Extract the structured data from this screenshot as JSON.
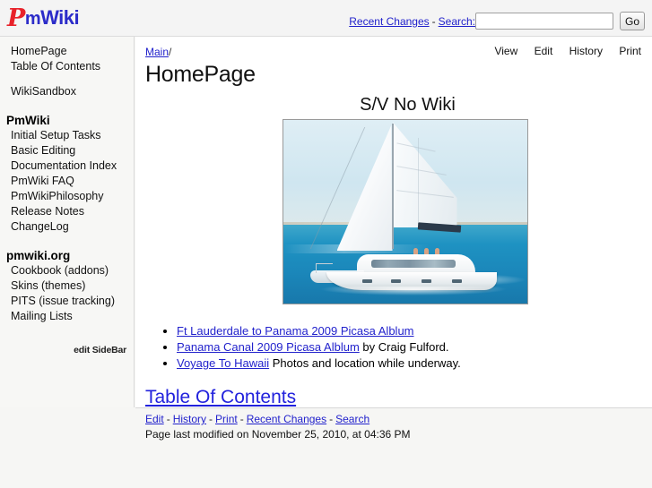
{
  "header": {
    "logo": {
      "p": "P",
      "m": "m",
      "wiki": "Wiki",
      "alt": "PmWiki"
    },
    "recent_changes_label": "Recent Changes",
    "separator": "-",
    "search_label": "Search:",
    "search_value": "",
    "search_placeholder": "",
    "go_label": "Go"
  },
  "sidebar": {
    "groups": [
      {
        "heading": null,
        "items": [
          "HomePage",
          "Table Of Contents"
        ]
      },
      {
        "heading": null,
        "items": [
          "WikiSandbox"
        ]
      },
      {
        "heading": "PmWiki",
        "items": [
          "Initial Setup Tasks",
          "Basic Editing",
          "Documentation Index",
          "PmWiki FAQ",
          "PmWikiPhilosophy",
          "Release Notes",
          "ChangeLog"
        ]
      },
      {
        "heading": "pmwiki.org",
        "items": [
          "Cookbook (addons)",
          "Skins (themes)",
          "PITS (issue tracking)",
          "Mailing Lists"
        ]
      }
    ],
    "edit_link": "edit SideBar"
  },
  "main": {
    "actions": [
      "View",
      "Edit",
      "History",
      "Print"
    ],
    "breadcrumb_group": "Main",
    "breadcrumb_separator": "/",
    "page_title": "HomePage",
    "photo_heading": "S/V No Wiki",
    "photo_alt": "Catamaran sailing on turquoise water",
    "links": [
      {
        "link": "Ft Lauderdale to Panama 2009 Picasa Alblum",
        "rest": ""
      },
      {
        "link": "Panama Canal 2009 Picasa Alblum",
        "rest": " by Craig Fulford."
      },
      {
        "link": "Voyage To Hawaii",
        "rest": " Photos and location while underway."
      }
    ],
    "toc_heading": "Table Of Contents"
  },
  "footer": {
    "links": [
      "Edit",
      "History",
      "Print",
      "Recent Changes",
      "Search"
    ],
    "separator": "-",
    "last_modified": "Page last modified on November 25, 2010, at 04:36 PM"
  },
  "colors": {
    "link": "#2222cc",
    "header_bg": "#f4f4f4",
    "sidebar_bg": "#f7f7f5",
    "content_bg": "#ffffff",
    "page_bg": "#f6f6f4",
    "logo_red": "#e8222a",
    "logo_blue": "#2c2cc9"
  }
}
